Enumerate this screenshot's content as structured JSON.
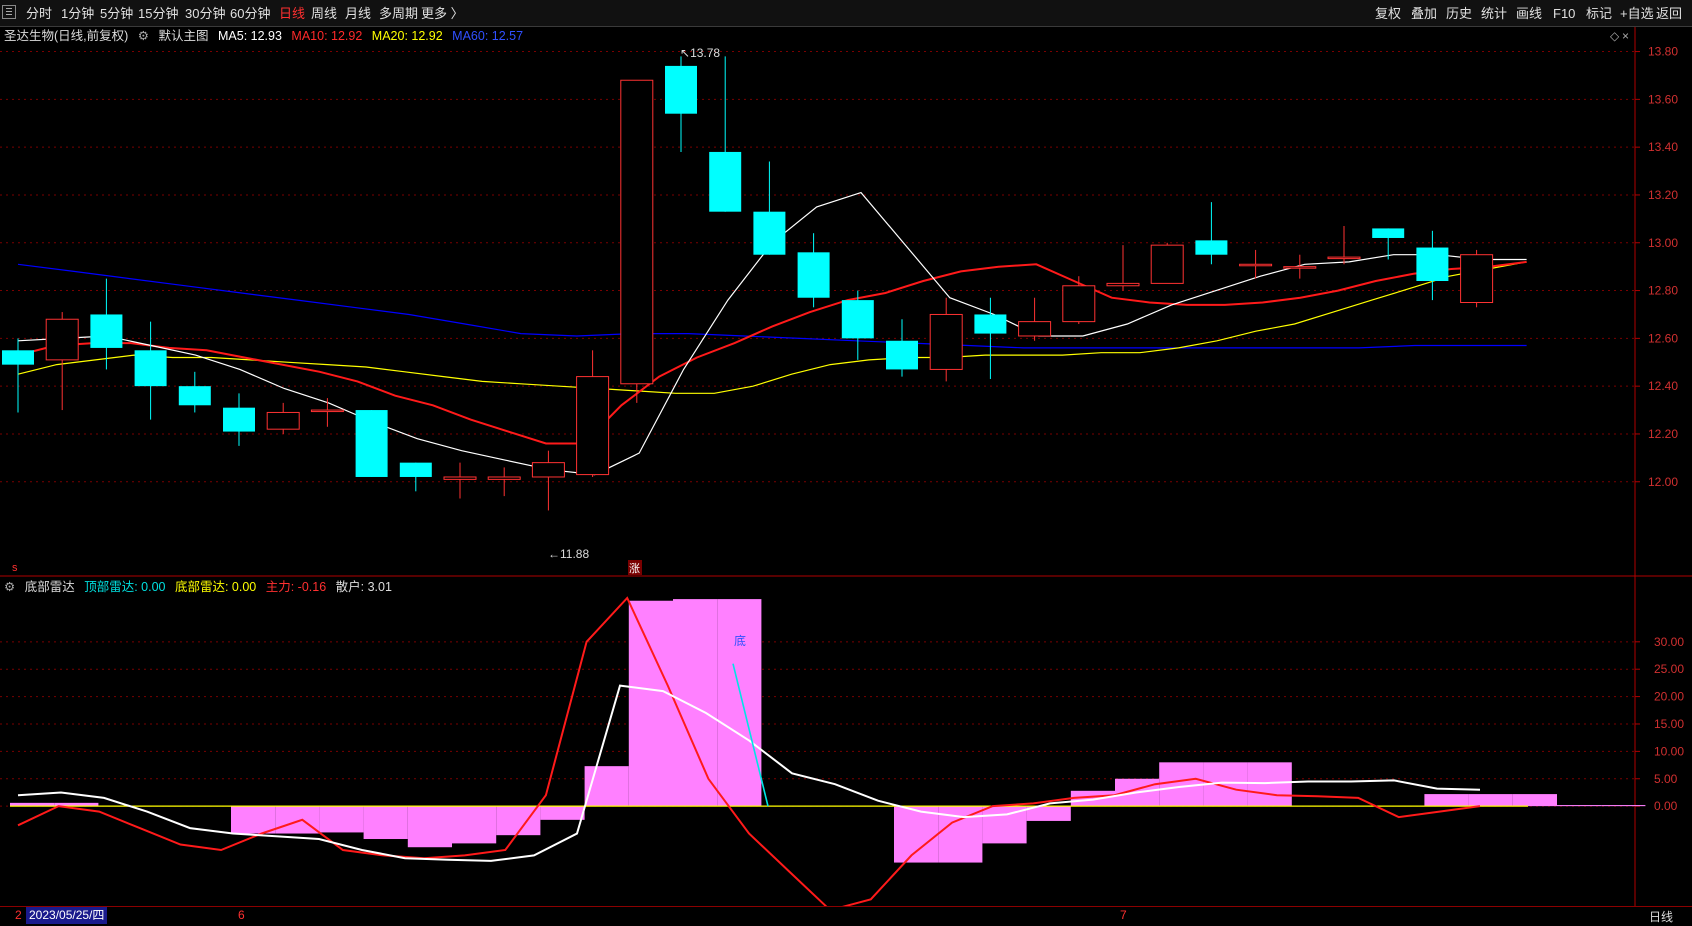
{
  "toolbar": {
    "periods": [
      {
        "label": "分时",
        "active": false
      },
      {
        "label": "1分钟",
        "active": false
      },
      {
        "label": "5分钟",
        "active": false
      },
      {
        "label": "15分钟",
        "active": false
      },
      {
        "label": "30分钟",
        "active": false
      },
      {
        "label": "60分钟",
        "active": false
      },
      {
        "label": "日线",
        "active": true
      },
      {
        "label": "周线",
        "active": false
      },
      {
        "label": "月线",
        "active": false
      },
      {
        "label": "多周期",
        "active": false
      },
      {
        "label": "更多",
        "active": false
      }
    ],
    "more_chevron": "〉",
    "right_buttons": [
      "复权",
      "叠加",
      "历史",
      "统计",
      "画线",
      "F10",
      "标记",
      "+自选",
      "返回"
    ]
  },
  "main_info": {
    "title": "圣达生物(日线,前复权)",
    "indicator": "默认主图",
    "ma5": "MA5: 12.93",
    "ma10": "MA10: 12.92",
    "ma20": "MA20: 12.92",
    "ma60": "MA60: 12.57"
  },
  "sub_info": {
    "title": "底部雷达",
    "top_radar": "顶部雷达: 0.00",
    "bottom_radar": "底部雷达: 0.00",
    "main_force": "主力: -0.16",
    "retail": "散户: 3.01"
  },
  "annotations": {
    "high": "13.78",
    "low": "11.88",
    "zhang_marker": "涨",
    "left_marker": "s",
    "sub_label": "底"
  },
  "status_bar": {
    "date": "2023/05/25/四",
    "month_6": "6",
    "month_7": "7",
    "left_digit": "2",
    "period": "日线"
  },
  "colors": {
    "up": "#ff3232",
    "down": "#00ffff",
    "ma5": "#ffffff",
    "ma10": "#ff1a1a",
    "ma20": "#ffff00",
    "ma60": "#0000ff",
    "bar": "#ff80ff",
    "axis": "#b00000"
  },
  "chart_data": [
    {
      "type": "candlestick",
      "title": "圣达生物(日线,前复权)",
      "ylim": [
        11.84,
        13.84
      ],
      "yticks": [
        12.0,
        12.2,
        12.4,
        12.6,
        12.8,
        13.0,
        13.2,
        13.4,
        13.6,
        13.8
      ],
      "candles": [
        {
          "o": 12.55,
          "h": 12.6,
          "l": 12.29,
          "c": 12.49
        },
        {
          "o": 12.51,
          "h": 12.71,
          "l": 12.3,
          "c": 12.68
        },
        {
          "o": 12.7,
          "h": 12.85,
          "l": 12.47,
          "c": 12.56
        },
        {
          "o": 12.55,
          "h": 12.67,
          "l": 12.26,
          "c": 12.4
        },
        {
          "o": 12.4,
          "h": 12.46,
          "l": 12.29,
          "c": 12.32
        },
        {
          "o": 12.31,
          "h": 12.37,
          "l": 12.15,
          "c": 12.21
        },
        {
          "o": 12.22,
          "h": 12.33,
          "l": 12.2,
          "c": 12.29
        },
        {
          "o": 12.3,
          "h": 12.35,
          "l": 12.23,
          "c": 12.3
        },
        {
          "o": 12.3,
          "h": 12.3,
          "l": 12.02,
          "c": 12.02
        },
        {
          "o": 12.08,
          "h": 12.08,
          "l": 11.96,
          "c": 12.02
        },
        {
          "o": 12.01,
          "h": 12.08,
          "l": 11.93,
          "c": 12.02
        },
        {
          "o": 12.01,
          "h": 12.06,
          "l": 11.94,
          "c": 12.02
        },
        {
          "o": 12.02,
          "h": 12.13,
          "l": 11.88,
          "c": 12.08
        },
        {
          "o": 12.03,
          "h": 12.55,
          "l": 12.02,
          "c": 12.44
        },
        {
          "o": 12.41,
          "h": 13.68,
          "l": 12.33,
          "c": 13.68
        },
        {
          "o": 13.74,
          "h": 13.78,
          "l": 13.38,
          "c": 13.54
        },
        {
          "o": 13.38,
          "h": 13.78,
          "l": 13.13,
          "c": 13.13
        },
        {
          "o": 13.13,
          "h": 13.34,
          "l": 12.95,
          "c": 12.95
        },
        {
          "o": 12.96,
          "h": 13.04,
          "l": 12.73,
          "c": 12.77
        },
        {
          "o": 12.76,
          "h": 12.8,
          "l": 12.51,
          "c": 12.6
        },
        {
          "o": 12.59,
          "h": 12.68,
          "l": 12.44,
          "c": 12.47
        },
        {
          "o": 12.47,
          "h": 12.77,
          "l": 12.42,
          "c": 12.7
        },
        {
          "o": 12.7,
          "h": 12.77,
          "l": 12.43,
          "c": 12.62
        },
        {
          "o": 12.61,
          "h": 12.77,
          "l": 12.59,
          "c": 12.67
        },
        {
          "o": 12.67,
          "h": 12.86,
          "l": 12.66,
          "c": 12.82
        },
        {
          "o": 12.82,
          "h": 12.99,
          "l": 12.8,
          "c": 12.83
        },
        {
          "o": 12.83,
          "h": 13.0,
          "l": 12.83,
          "c": 12.99
        },
        {
          "o": 13.01,
          "h": 13.17,
          "l": 12.91,
          "c": 12.95
        },
        {
          "o": 12.91,
          "h": 12.97,
          "l": 12.85,
          "c": 12.91
        },
        {
          "o": 12.9,
          "h": 12.95,
          "l": 12.85,
          "c": 12.9
        },
        {
          "o": 12.94,
          "h": 13.07,
          "l": 12.91,
          "c": 12.94
        },
        {
          "o": 13.06,
          "h": 13.06,
          "l": 12.93,
          "c": 13.02
        },
        {
          "o": 12.98,
          "h": 13.05,
          "l": 12.76,
          "c": 12.84
        },
        {
          "o": 12.75,
          "h": 12.97,
          "l": 12.73,
          "c": 12.95
        }
      ],
      "series": [
        {
          "name": "MA5",
          "values": [
            12.59,
            12.6,
            12.61,
            12.57,
            12.53,
            12.47,
            12.39,
            12.33,
            12.25,
            12.18,
            12.13,
            12.09,
            12.05,
            12.03,
            12.12,
            12.47,
            12.76,
            13.0,
            13.15,
            13.21,
            12.99,
            12.77,
            12.7,
            12.61,
            12.61,
            12.66,
            12.74,
            12.8,
            12.86,
            12.91,
            12.92,
            12.95,
            12.95,
            12.93,
            12.93
          ]
        },
        {
          "name": "MA10",
          "values": [
            12.53,
            12.57,
            12.58,
            12.58,
            12.56,
            12.55,
            12.52,
            12.49,
            12.46,
            12.42,
            12.36,
            12.32,
            12.26,
            12.21,
            12.16,
            12.16,
            12.32,
            12.44,
            12.52,
            12.58,
            12.65,
            12.71,
            12.76,
            12.79,
            12.84,
            12.88,
            12.9,
            12.91,
            12.84,
            12.77,
            12.75,
            12.74,
            12.74,
            12.75,
            12.77,
            12.8,
            12.84,
            12.87,
            12.89,
            12.9,
            12.92
          ]
        },
        {
          "name": "MA20",
          "values": [
            12.45,
            12.49,
            12.51,
            12.53,
            12.52,
            12.52,
            12.51,
            12.5,
            12.49,
            12.48,
            12.46,
            12.44,
            12.42,
            12.41,
            12.4,
            12.39,
            12.38,
            12.37,
            12.37,
            12.4,
            12.45,
            12.49,
            12.51,
            12.52,
            12.52,
            12.53,
            12.53,
            12.53,
            12.54,
            12.54,
            12.56,
            12.59,
            12.63,
            12.66,
            12.71,
            12.76,
            12.81,
            12.86,
            12.89,
            12.92
          ]
        },
        {
          "name": "MA60",
          "values": [
            12.91,
            12.88,
            12.85,
            12.82,
            12.79,
            12.76,
            12.73,
            12.7,
            12.66,
            12.62,
            12.61,
            12.62,
            12.62,
            12.61,
            12.6,
            12.59,
            12.58,
            12.57,
            12.56,
            12.56,
            12.56,
            12.56,
            12.56,
            12.56,
            12.56,
            12.57,
            12.57,
            12.57
          ]
        }
      ]
    },
    {
      "type": "bar",
      "title": "底部雷达",
      "ylim": [
        -17.5,
        38
      ],
      "yticks": [
        0.0,
        5.0,
        10.0,
        15.0,
        20.0,
        25.0,
        30.0
      ],
      "bars": [
        0.6,
        0.6,
        0,
        0,
        0,
        -5,
        -5,
        -4.8,
        -6,
        -7.5,
        -6.8,
        -5.3,
        -2.5,
        7.3,
        37.5,
        37.8,
        37.8,
        0,
        0,
        0,
        -10.3,
        -10.3,
        -6.8,
        -2.7,
        2.8,
        5.0,
        8.0,
        8.0,
        8.0,
        0,
        0,
        0,
        2.2,
        2.2,
        2.2,
        0.2,
        0.2
      ],
      "series": [
        {
          "name": "主力",
          "values": [
            -3.5,
            0,
            -1,
            -4,
            -7,
            -8,
            -5,
            -2.5,
            -8,
            -9,
            -9.5,
            -9,
            -8,
            2,
            30,
            38,
            22,
            5,
            -5,
            -12,
            -19,
            -17,
            -9,
            -3,
            0,
            0.5,
            1.5,
            2,
            4,
            5,
            3,
            2,
            1.8,
            1.5,
            -2,
            -1,
            0
          ]
        },
        {
          "name": "散户",
          "values": [
            2,
            2.5,
            1.5,
            -1,
            -4,
            -5,
            -5.5,
            -6,
            -8,
            -9.5,
            -9.8,
            -10,
            -9,
            -5,
            22,
            21,
            17,
            12,
            6,
            4,
            1,
            -1,
            -2,
            -1.5,
            0.5,
            1.2,
            2.5,
            3.5,
            4.3,
            4.2,
            4.5,
            4.5,
            4.7,
            3.2,
            3.0
          ]
        }
      ]
    }
  ]
}
